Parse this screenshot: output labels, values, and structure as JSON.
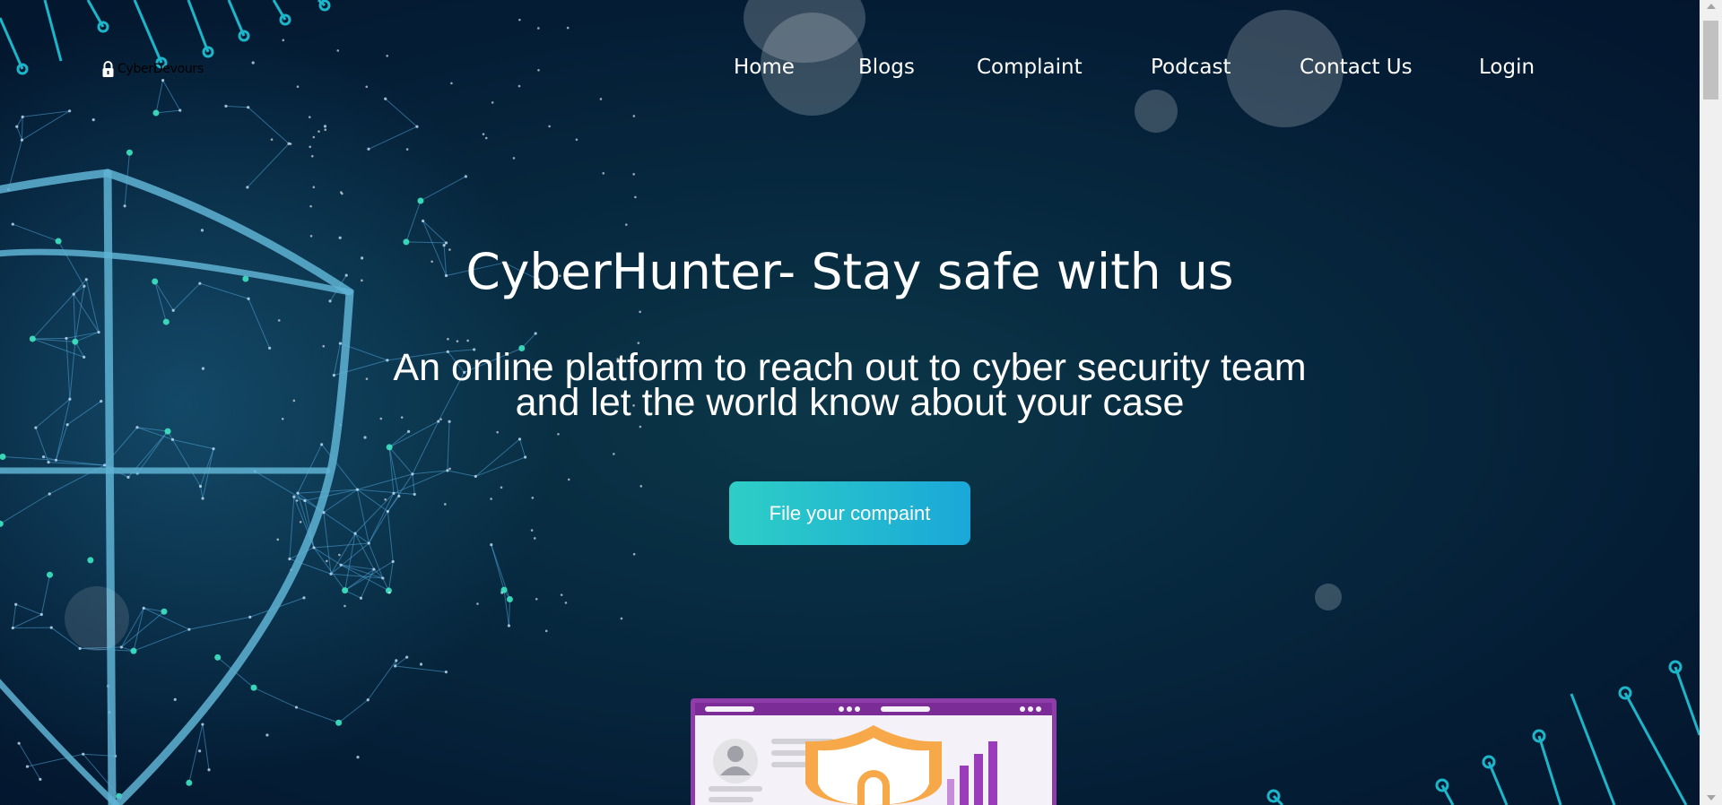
{
  "logo": {
    "text": "CyberDevours",
    "icon": "padlock-icon"
  },
  "nav": {
    "items": [
      {
        "label": "Home"
      },
      {
        "label": "Blogs"
      },
      {
        "label": "Complaint"
      },
      {
        "label": "Podcast"
      },
      {
        "label": "Contact Us"
      },
      {
        "label": "Login"
      }
    ]
  },
  "hero": {
    "title": "CyberHunter- Stay safe with us",
    "subtitle_line1": "An online platform to reach out to cyber security team",
    "subtitle_line2": "and let the world know about your case",
    "cta_label": "File your compaint"
  },
  "colors": {
    "background": "#041d35",
    "accent": "#2ecec6",
    "button_end": "#1aa8d8",
    "text": "#ffffff"
  },
  "icons": [
    "padlock-icon",
    "shield-network-graphic",
    "security-dashboard-illustration",
    "circuit-line-decoration"
  ]
}
